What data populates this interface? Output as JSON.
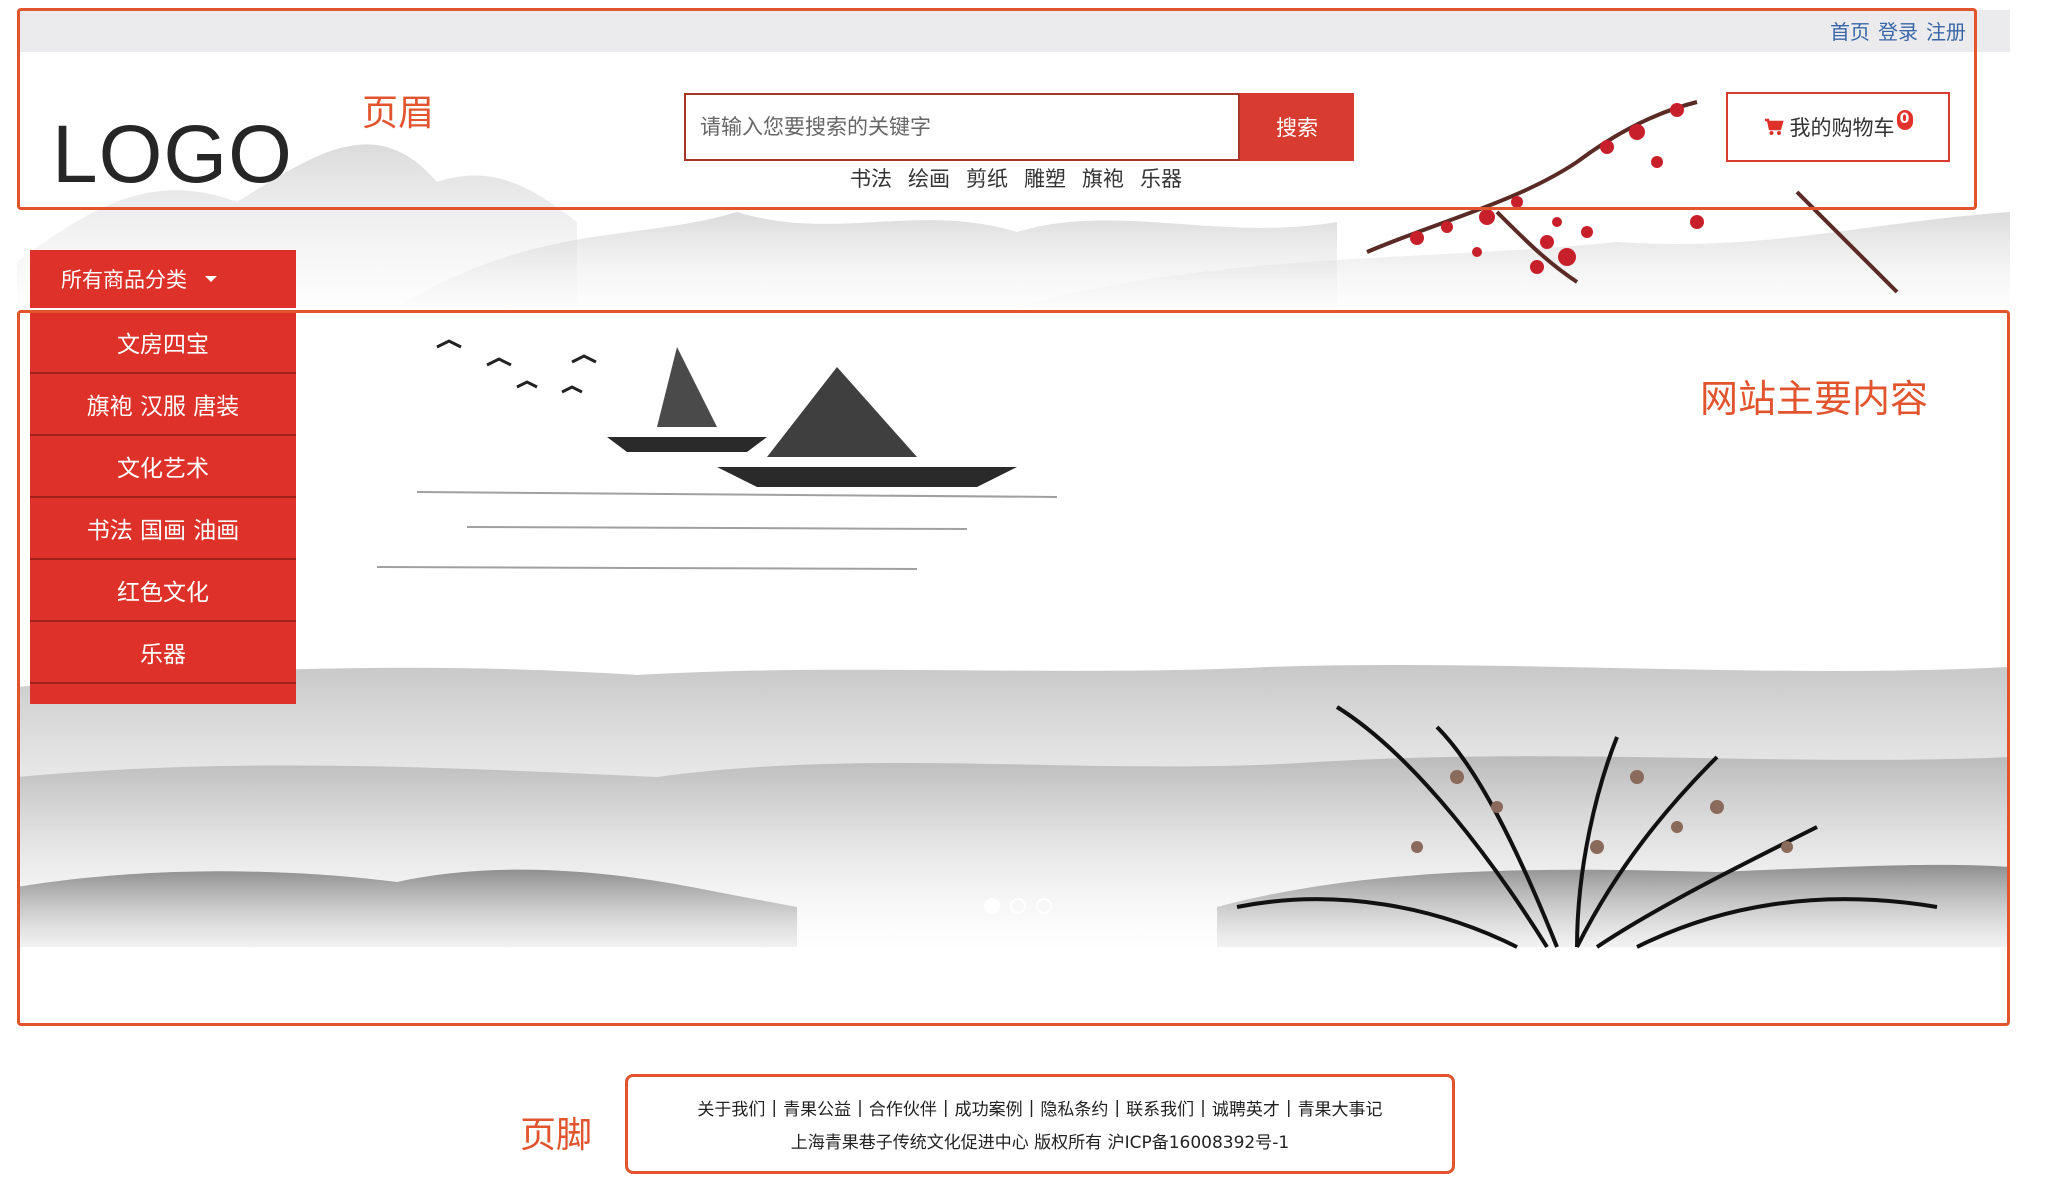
{
  "top_nav": {
    "links": [
      "首页",
      "登录",
      "注册"
    ]
  },
  "logo": {
    "text": "LOGO"
  },
  "annotations": {
    "header": "页眉",
    "main": "网站主要内容",
    "footer": "页脚"
  },
  "search": {
    "placeholder": "请输入您要搜索的关键字",
    "button": "搜索",
    "hot_words": [
      "书法",
      "绘画",
      "剪纸",
      "雕塑",
      "旗袍",
      "乐器"
    ]
  },
  "cart": {
    "label": "我的购物车",
    "count": "0",
    "icon": "cart-icon"
  },
  "category": {
    "title": "所有商品分类",
    "items": [
      "文房四宝",
      "旗袍 汉服 唐装",
      "文化艺术",
      "书法 国画 油画",
      "红色文化",
      "乐器"
    ]
  },
  "carousel": {
    "slides": 3,
    "active": 1
  },
  "footer": {
    "links": [
      "关于我们",
      "青果公益",
      "合作伙伴",
      "成功案例",
      "隐私条约",
      "联系我们",
      "诚聘英才",
      "青果大事记"
    ],
    "separator": "|",
    "copyright": "上海青果巷子传统文化促进中心 版权所有 沪ICP备16008392号-1"
  },
  "colors": {
    "accent": "#dd3129",
    "annotation": "#e2542e",
    "link": "#3a66a8"
  }
}
